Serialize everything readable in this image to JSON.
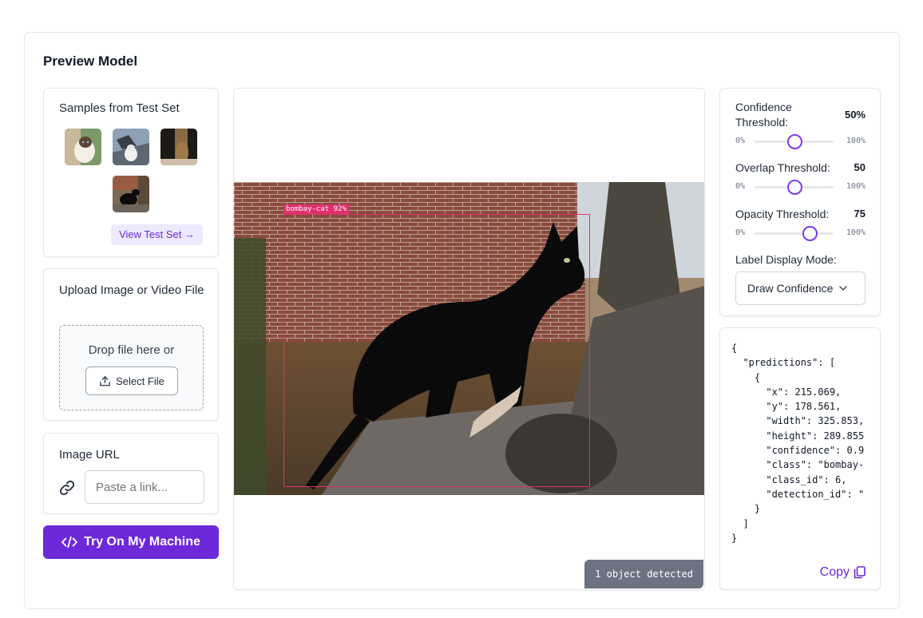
{
  "page": {
    "title": "Preview Model"
  },
  "samples": {
    "title": "Samples from Test Set",
    "view_link": "View Test Set →",
    "thumbs": [
      "cat-sample-1",
      "cat-sample-2",
      "cat-sample-3",
      "cat-sample-4"
    ]
  },
  "upload": {
    "title": "Upload Image or Video File",
    "drop_text": "Drop file here or",
    "select_label": "Select File"
  },
  "url": {
    "title": "Image URL",
    "placeholder": "Paste a link..."
  },
  "try_button": "Try On My Machine",
  "preview": {
    "detection_label": "bombay-cat 92%",
    "detected_count": "1 object detected"
  },
  "settings": {
    "confidence": {
      "label": "Confidence Threshold:",
      "value": "50%",
      "level": 50,
      "min": "0%",
      "max": "100%"
    },
    "overlap": {
      "label": "Overlap Threshold:",
      "value": "50",
      "level": 50,
      "min": "0%",
      "max": "100%"
    },
    "opacity": {
      "label": "Opacity Threshold:",
      "value": "75",
      "level": 70,
      "min": "0%",
      "max": "100%"
    },
    "label_mode": {
      "label": "Label Display Mode:",
      "selected": "Draw Confidence"
    }
  },
  "json_output": "{\n  \"predictions\": [\n    {\n      \"x\": 215.069,\n      \"y\": 178.561,\n      \"width\": 325.853,\n      \"height\": 289.855\n      \"confidence\": 0.9\n      \"class\": \"bombay-\n      \"class_id\": 6,\n      \"detection_id\": \"\n    }\n  ]\n}",
  "copy_label": "Copy",
  "colors": {
    "accent": "#6d28d9",
    "box": "#e0306f"
  }
}
